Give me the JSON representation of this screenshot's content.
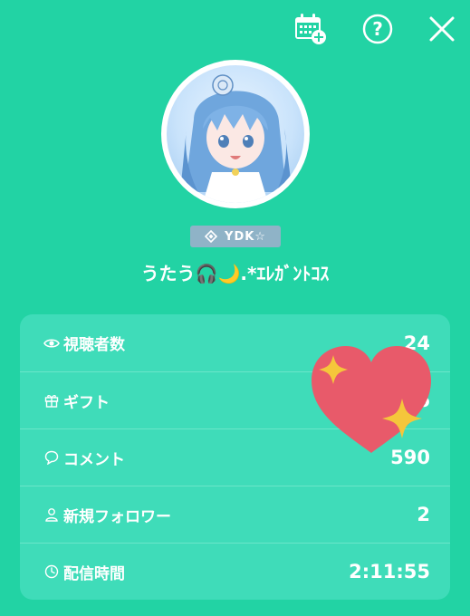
{
  "toolbar": {
    "calendar_icon": "calendar-add-icon",
    "help_icon": "question-circle-icon",
    "close_icon": "close-x-icon"
  },
  "profile": {
    "badge_text": "YDK☆",
    "name": "うたう🎧🌙.*ｴﾚｶﾞﾝﾄｺｽ"
  },
  "stats": [
    {
      "icon": "eye-icon",
      "label": "視聴者数",
      "value": "24"
    },
    {
      "icon": "gift-icon",
      "label": "ギフト",
      "value": "6"
    },
    {
      "icon": "comment-icon",
      "label": "コメント",
      "value": "590"
    },
    {
      "icon": "person-icon",
      "label": "新規フォロワー",
      "value": "2"
    },
    {
      "icon": "clock-icon",
      "label": "配信時間",
      "value": "2:11:55"
    }
  ],
  "colors": {
    "background": "#22d3a4",
    "card": "#3fdcb9",
    "badge": "#8fb3c7",
    "heart": "#e85a6a",
    "sparkle": "#f5c63b"
  }
}
